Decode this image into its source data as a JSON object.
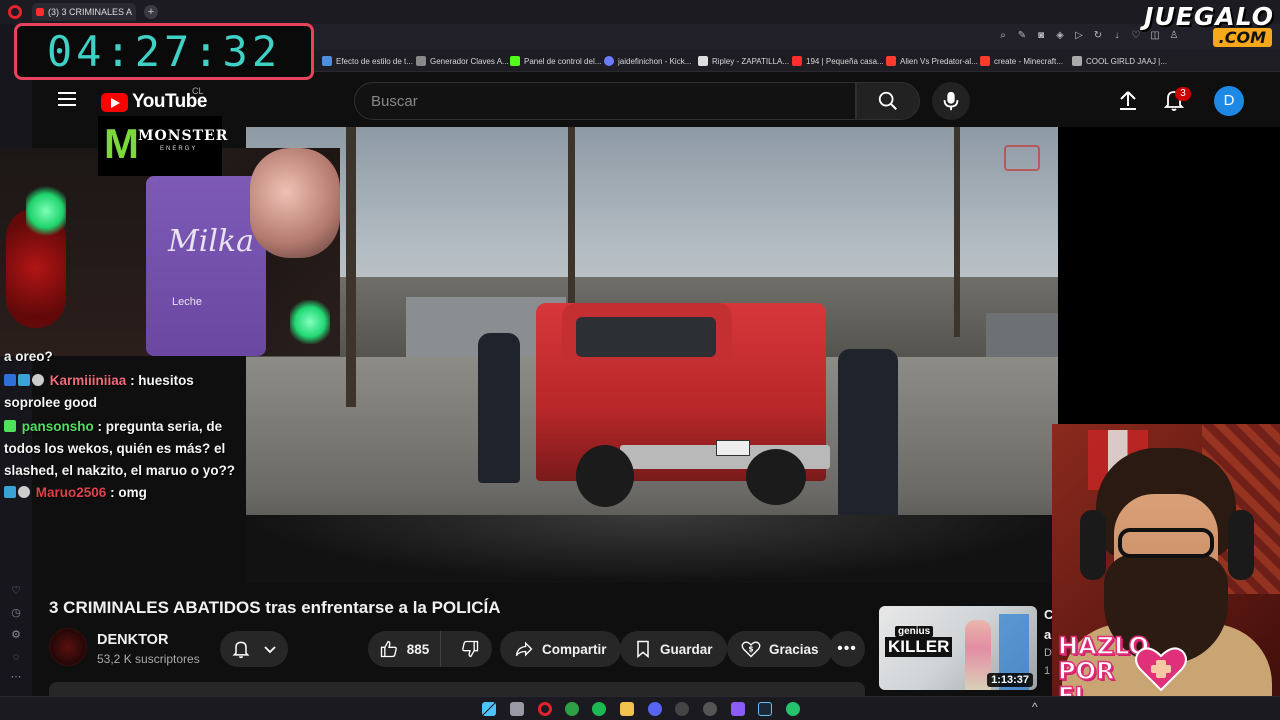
{
  "browser": {
    "tab_title": "(3) 3 CRIMINALES AB/",
    "tab_add": "+",
    "bookmarks": [
      {
        "label": "Efecto de estilo de t...",
        "color": "#4a90e2"
      },
      {
        "label": "Generador Claves A...",
        "color": "#888888"
      },
      {
        "label": "Panel de control del...",
        "color": "#53fc18"
      },
      {
        "label": "jaidefinichon - Kick...",
        "color": "#6b7cff"
      },
      {
        "label": "Ripley - ZAPATILLA...",
        "color": "#dddddd"
      },
      {
        "label": "194 | Pequeña casa...",
        "color": "#ff2d2d"
      },
      {
        "label": "Alien Vs Predator-al...",
        "color": "#ff3b30"
      },
      {
        "label": "create - Minecraft...",
        "color": "#ff3b30"
      },
      {
        "label": "COOL GIRLD JAAJ |...",
        "color": "#aaaaaa"
      }
    ]
  },
  "overlay": {
    "timer": "04:27:32",
    "juegalo_top": "JUEGALO",
    "juegalo_bottom": ".COM",
    "monster_word": "MONSTER",
    "monster_sub": "ENERGY",
    "milka_word": "Milka",
    "milka_sub": "Leche",
    "hazlo_lines": [
      "HAZLO",
      "POR",
      "EL"
    ]
  },
  "youtube": {
    "logo_text": "YouTube",
    "region": "CL",
    "search_placeholder": "Buscar",
    "notification_count": "3",
    "avatar_letter": "D",
    "video_title": "3 CRIMINALES ABATIDOS tras enfrentarse a la POLICÍA",
    "channel_name": "DENKTOR",
    "subscribers": "53,2 K suscriptores",
    "like_count": "885",
    "share_label": "Compartir",
    "save_label": "Guardar",
    "thanks_label": "Gracias",
    "more_label": "•••",
    "related": {
      "thumb_small": "genius",
      "thumb_big": "KILLER",
      "duration": "1:13:37",
      "cut_title_1": "C",
      "cut_title_2": "a",
      "cut_meta_1": "D",
      "cut_meta_2": "1"
    }
  },
  "chat": {
    "lines": [
      {
        "user": "",
        "text": "a oreo?",
        "user_color": "#ffffff"
      },
      {
        "user": "Karmiiiniiaa",
        "text": ": huesitos soprolee good",
        "user_color": "#f06b7b"
      },
      {
        "user": "pansonsho",
        "text": ": pregunta seria, de todos los wekos, quién es más? el slashed, el nakzito, el maruo o yo??",
        "user_color": "#4fe05c"
      },
      {
        "user": "Maruo2506",
        "text": ": omg",
        "user_color": "#e0424a"
      }
    ]
  },
  "colors": {
    "accent_red": "#ff0000",
    "timer_border": "#e8425c",
    "timer_text": "#3fd1c6"
  }
}
